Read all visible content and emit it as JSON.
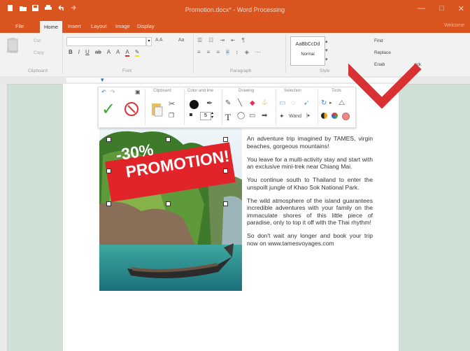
{
  "window": {
    "title": "Promotion.docx* - Word Processing",
    "controls": [
      "—",
      "□",
      "✕"
    ]
  },
  "qat": {
    "icons": [
      "new-icon",
      "open-icon",
      "save-icon",
      "print-icon",
      "undo-icon",
      "redo-icon"
    ]
  },
  "tabs": {
    "items": [
      "File",
      "Home",
      "Insert",
      "Layout",
      "Image",
      "Display"
    ],
    "active": "Home",
    "login": "Welcome"
  },
  "ribbon": {
    "clipboard": {
      "label": "Clipboard",
      "paste": "Paste",
      "cut": "Cut",
      "copy": "Copy"
    },
    "font": {
      "label": "Font",
      "size_btn": "A A",
      "case": "Aa"
    },
    "paragraph": {
      "label": "Paragraph"
    },
    "style": {
      "label": "Style",
      "preview": "AaBbCcDd",
      "name": "Normal"
    },
    "editing": {
      "find": "Find",
      "replace": "Replace",
      "enable": "Enab",
      "check": "eck"
    }
  },
  "toolbar": {
    "sections": [
      "Clipboard",
      "Color and line",
      "Drawing",
      "Selection",
      "Tools"
    ],
    "line_width": "5",
    "wand_label": "Wand"
  },
  "document": {
    "banner_line1": "-30%",
    "banner_line2": "PROMOTION!",
    "paragraphs": [
      "An adventure trip imagined by TAMES, virgin beaches, gorgeous mountains!",
      "You leave for a multi-activity stay and start with an exclusive mini-trek near Chiang Mai.",
      "You continue south to Thailand to enter the unspoilt jungle of Khao Sok National Park.",
      "The wild atmosphere of the island guarantees incredible adventures with your family on the immaculate shores of this little piece of paradise, only to top it off with the Thai rhythm!",
      "So don't wait any longer and book your trip now on www.tamesvoyages.com"
    ]
  },
  "colors": {
    "accent": "#d9541e",
    "arrow": "#d93032",
    "banner": "#e0242a"
  }
}
